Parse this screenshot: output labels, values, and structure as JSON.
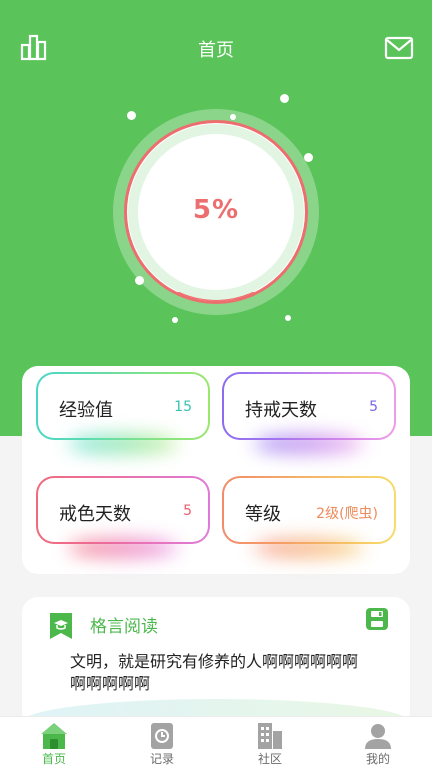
{
  "header": {
    "title": "首页",
    "left_icon": "bar-chart-icon",
    "right_icon": "mail-icon"
  },
  "progress": {
    "label": "5%",
    "value": 0.05
  },
  "stats": [
    {
      "label": "经验值",
      "value": "15"
    },
    {
      "label": "持戒天数",
      "value": "5"
    },
    {
      "label": "戒色天数",
      "value": "5"
    },
    {
      "label": "等级",
      "value": "2级(爬虫)"
    }
  ],
  "quote": {
    "title": "格言阅读",
    "text": "文明，就是研究有修养的人啊啊啊啊啊啊啊啊啊啊啊",
    "icon": "book-icon",
    "action_icon": "save-icon"
  },
  "tabs": [
    {
      "label": "首页",
      "icon": "home-icon",
      "active": true
    },
    {
      "label": "记录",
      "icon": "record-icon",
      "active": false
    },
    {
      "label": "社区",
      "icon": "community-icon",
      "active": false
    },
    {
      "label": "我的",
      "icon": "profile-icon",
      "active": false
    }
  ],
  "colors": {
    "primary": "#5ac35a",
    "progress_ring": "#ec6e6e",
    "accent_green": "#4cb84c"
  }
}
